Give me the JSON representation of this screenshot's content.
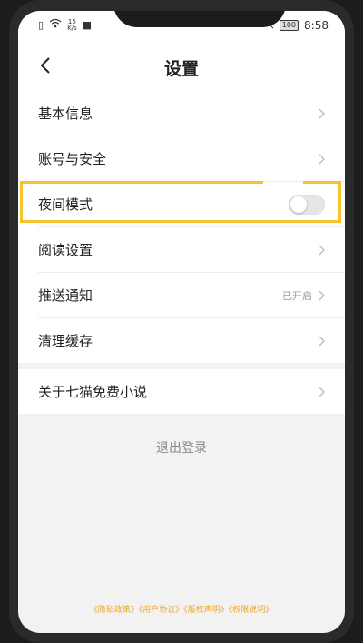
{
  "status_bar": {
    "network_speed_value": "15",
    "network_speed_unit": "K/s",
    "battery": "100",
    "time": "8:58"
  },
  "header": {
    "title": "设置"
  },
  "group1": {
    "items": [
      {
        "label": "基本信息"
      },
      {
        "label": "账号与安全"
      },
      {
        "label": "夜间模式",
        "toggle": false
      },
      {
        "label": "阅读设置"
      },
      {
        "label": "推送通知",
        "value": "已开启"
      },
      {
        "label": "清理缓存"
      }
    ]
  },
  "group2": {
    "items": [
      {
        "label": "关于七猫免费小说"
      }
    ]
  },
  "logout_label": "退出登录",
  "footer": {
    "links": "《隐私政策》《用户协议》《版权声明》《权限说明》"
  },
  "colors": {
    "highlight": "#f6c22c",
    "footer_link": "#f0a630"
  }
}
